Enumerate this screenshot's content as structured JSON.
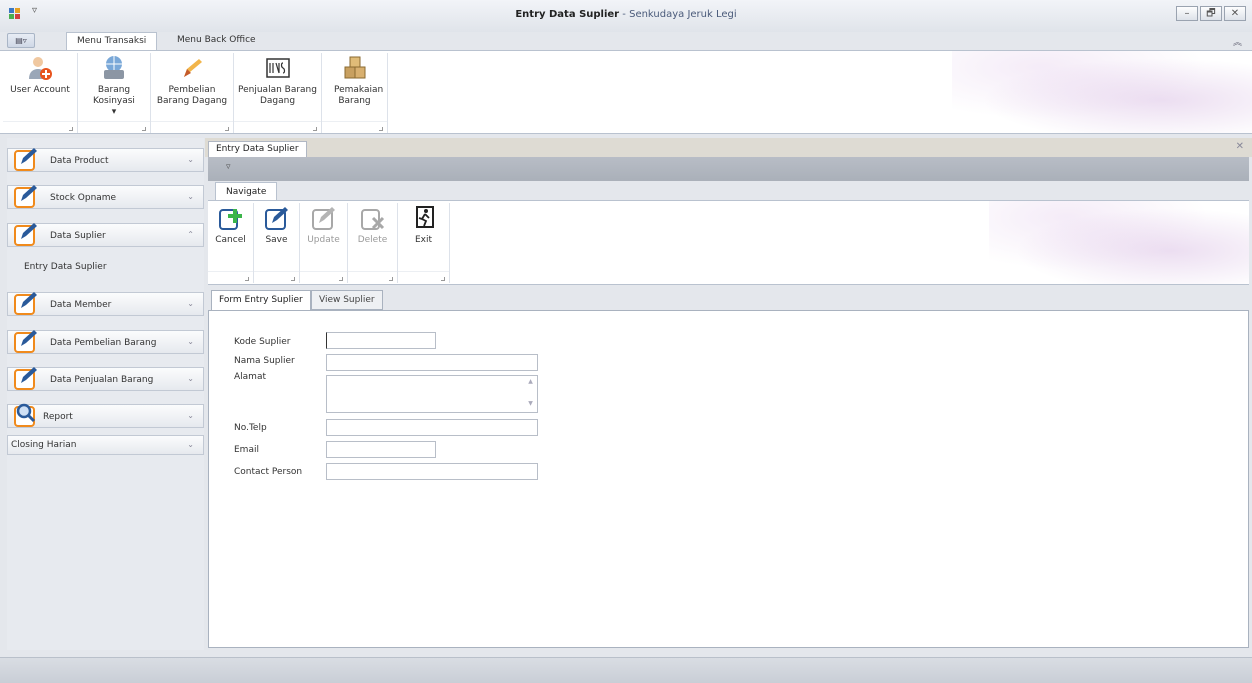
{
  "window": {
    "title_main": "Entry Data Suplier",
    "title_separator": " - ",
    "title_app": "Senkudaya Jeruk Legi",
    "qat_glyph": "▿",
    "min_glyph": "–",
    "restore_glyph": "🗗",
    "close_glyph": "✕"
  },
  "ribbon": {
    "appmenu_glyph": "▤▿",
    "tabs": [
      {
        "label": "Menu Transaksi"
      },
      {
        "label": "Menu Back Office"
      }
    ],
    "collapse_glyph": "︽",
    "buttons": [
      {
        "label": "User Account",
        "icon": "user-add-icon"
      },
      {
        "label": "Barang Kosinyasi ▾",
        "icon": "globe-printer-icon"
      },
      {
        "label": "Pembelian Barang Dagang",
        "icon": "pen-icon"
      },
      {
        "label": "Penjualan Barang Dagang",
        "icon": "stamp-icon"
      },
      {
        "label": "Pemakaian Barang",
        "icon": "boxes-icon"
      }
    ]
  },
  "nav": {
    "groups": [
      {
        "label": "Data Product",
        "chevron": "⌄"
      },
      {
        "label": "Stock Opname",
        "chevron": "⌄"
      },
      {
        "label": "Data Suplier",
        "chevron": "⌃"
      },
      {
        "label": "Data Member",
        "chevron": "⌄"
      },
      {
        "label": "Data Pembelian Barang",
        "chevron": "⌄"
      },
      {
        "label": "Data Penjualan Barang",
        "chevron": "⌄"
      },
      {
        "label": "Report",
        "chevron": "⌄"
      },
      {
        "label": "Closing Harian",
        "chevron": "⌄"
      }
    ],
    "child_item": "Entry Data Suplier"
  },
  "document": {
    "tab_label": "Entry Data Suplier",
    "close_glyph": "✕",
    "inner_qat_glyph": "▿",
    "inner_tab": "Navigate",
    "actions": [
      {
        "label": "Cancel",
        "icon": "add-icon",
        "enabled": true
      },
      {
        "label": "Save",
        "icon": "edit-icon",
        "enabled": true
      },
      {
        "label": "Update",
        "icon": "edit-icon",
        "enabled": false
      },
      {
        "label": "Delete",
        "icon": "delete-icon",
        "enabled": false
      },
      {
        "label": "Exit",
        "icon": "exit-icon",
        "enabled": true
      }
    ],
    "form_tabs": [
      {
        "label": "Form Entry Suplier"
      },
      {
        "label": "View Suplier"
      }
    ],
    "fields": {
      "kode_label": "Kode Suplier",
      "kode_value": "",
      "nama_label": "Nama Suplier",
      "nama_value": "",
      "alamat_label": "Alamat",
      "alamat_value": "",
      "telp_label": "No.Telp",
      "telp_value": "",
      "email_label": "Email",
      "email_value": "",
      "contact_label": "Contact Person",
      "contact_value": ""
    },
    "scroll_up_glyph": "▲",
    "scroll_down_glyph": "▼"
  },
  "colors": {
    "accent_orange": "#f08a1c",
    "pen_blue": "#2a5a9a",
    "plus_green": "#3bb54a",
    "ribbon_swirl": "#c8a0d7"
  }
}
